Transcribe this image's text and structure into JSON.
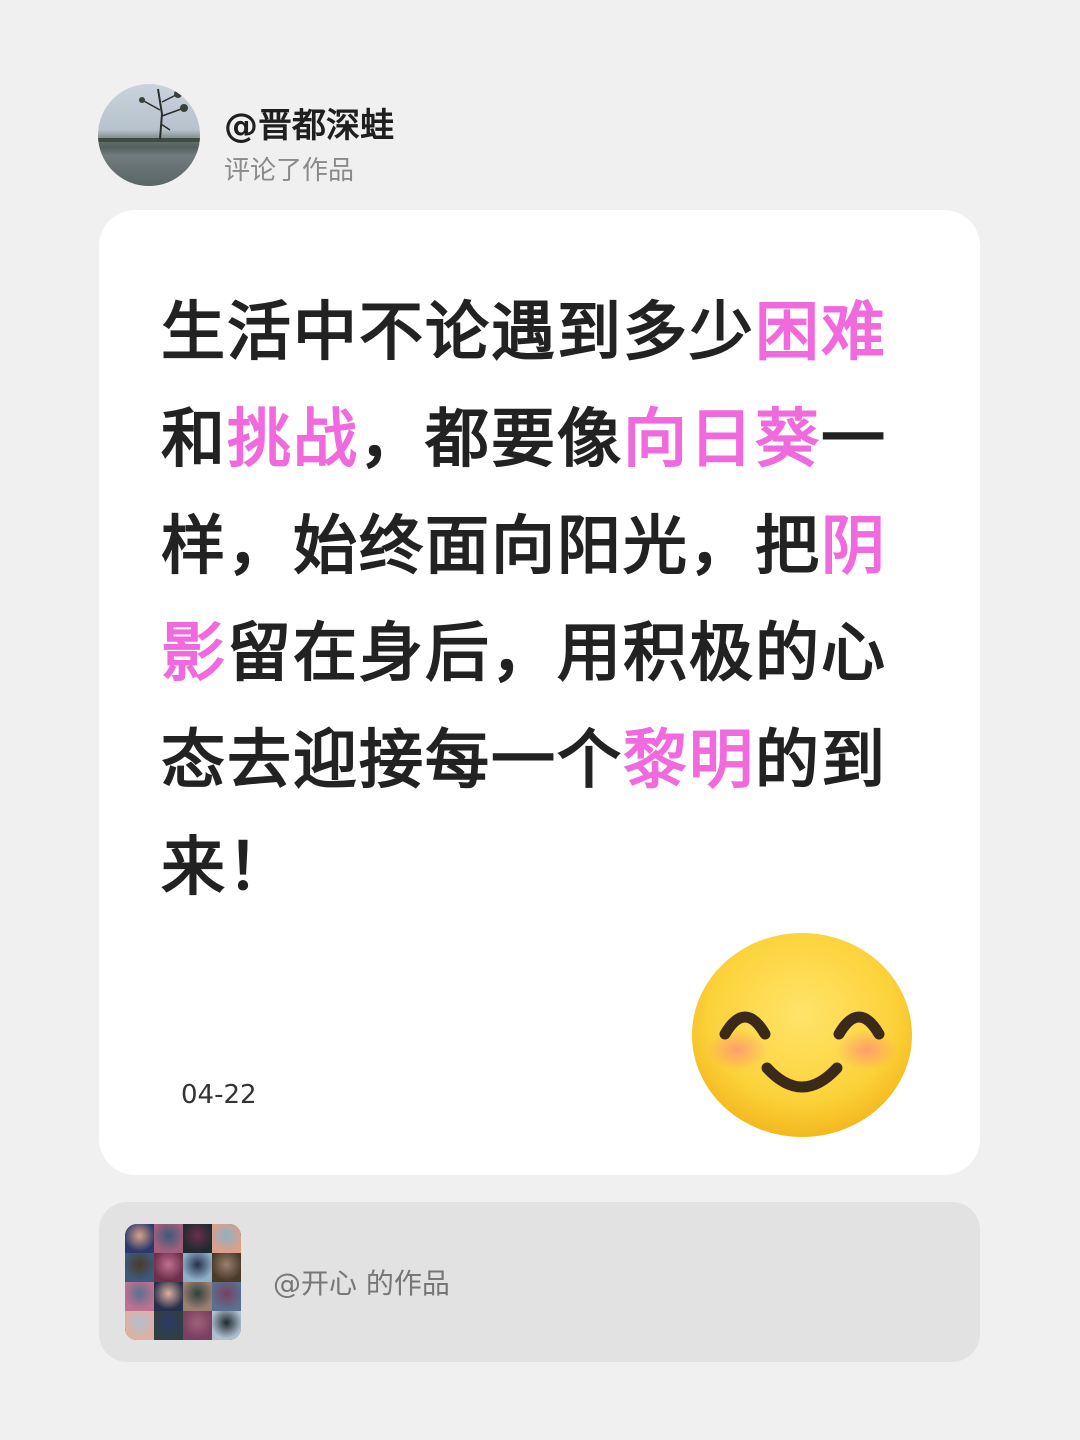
{
  "header": {
    "username": "@晋都深蛙",
    "action": "评论了作品"
  },
  "comment": {
    "segments": [
      {
        "text": "生活中不论遇到多少",
        "highlight": false
      },
      {
        "text": "困难",
        "highlight": true
      },
      {
        "text": "和",
        "highlight": false
      },
      {
        "text": "挑战",
        "highlight": true
      },
      {
        "text": "，都要像",
        "highlight": false
      },
      {
        "text": "向日葵",
        "highlight": true
      },
      {
        "text": "一样，始终面向阳光，把",
        "highlight": false
      },
      {
        "text": "阴影",
        "highlight": true
      },
      {
        "text": "留在身后，用积极的心态去迎接每一个",
        "highlight": false
      },
      {
        "text": "黎明",
        "highlight": true
      },
      {
        "text": "的到来！",
        "highlight": false
      }
    ],
    "date": "04-22",
    "emoji": "smiling-face-emoji"
  },
  "referenced_work": {
    "label": "@开心 的作品"
  },
  "colors": {
    "highlight": "#f06ade",
    "text": "#222222",
    "background": "#f0f0f0",
    "card": "#ffffff",
    "ref_card": "#e2e2e2"
  }
}
